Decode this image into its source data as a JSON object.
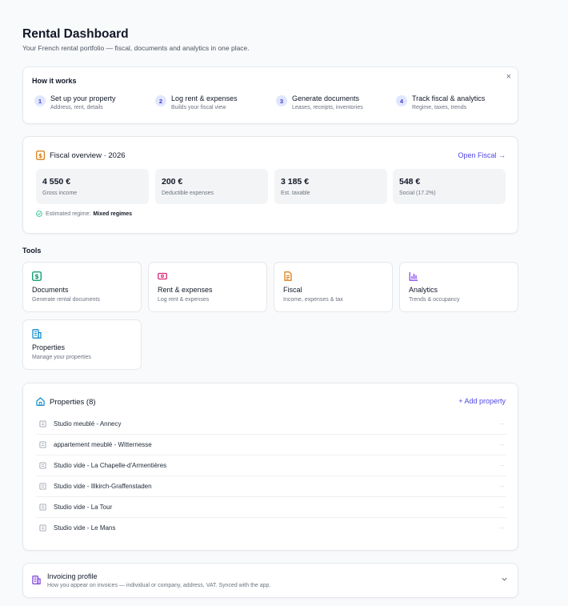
{
  "header": {
    "title": "Rental Dashboard",
    "subtitle": "Your French rental portfolio — fiscal, documents and analytics in one place."
  },
  "how_it_works": {
    "title": "How it works",
    "close_icon": "×",
    "steps": [
      {
        "num": "1",
        "title": "Set up your property",
        "desc": "Address, rent, details"
      },
      {
        "num": "2",
        "title": "Log rent & expenses",
        "desc": "Builds your fiscal view"
      },
      {
        "num": "3",
        "title": "Generate documents",
        "desc": "Leases, receipts, inventories"
      },
      {
        "num": "4",
        "title": "Track fiscal & analytics",
        "desc": "Regime, taxes, trends"
      }
    ]
  },
  "fiscal": {
    "title": "Fiscal overview · 2026",
    "link": "Open Fiscal →",
    "stats": [
      {
        "value": "4 550 €",
        "label": "Gross income"
      },
      {
        "value": "200 €",
        "label": "Deductible expenses"
      },
      {
        "value": "3 185 €",
        "label": "Est. taxable"
      },
      {
        "value": "548 €",
        "label": "Social (17.2%)"
      }
    ],
    "regime_label": "Estimated regime:",
    "regime_value": "Mixed regimes"
  },
  "tools": {
    "heading": "Tools",
    "items": [
      {
        "title": "Documents",
        "desc": "Generate rental documents",
        "icon": "document-dollar-icon",
        "color": "#059669"
      },
      {
        "title": "Rent & expenses",
        "desc": "Log rent & expenses",
        "icon": "banknote-icon",
        "color": "#db2777"
      },
      {
        "title": "Fiscal",
        "desc": "Income, expenses & tax",
        "icon": "file-text-icon",
        "color": "#d97706"
      },
      {
        "title": "Analytics",
        "desc": "Trends & occupancy",
        "icon": "bar-chart-icon",
        "color": "#7c3aed"
      },
      {
        "title": "Properties",
        "desc": "Manage your properties",
        "icon": "building-icon",
        "color": "#0284c7"
      }
    ]
  },
  "properties": {
    "title": "Properties (8)",
    "add_label": "+ Add property",
    "items": [
      "Studio meublé - Annecy",
      "appartement meublé - Witternesse",
      "Studio vide - La Chapelle-d'Armentières",
      "Studio vide - Illkirch-Graffenstaden",
      "Studio vide - La Tour",
      "Studio vide - Le Mans"
    ],
    "arrow": "→"
  },
  "invoicing": {
    "title": "Invoicing profile",
    "desc": "How you appear on invoices — individual or company, address, VAT. Synced with the app."
  },
  "colors": {
    "accent": "#4f46e5",
    "fiscal_icon": "#d97706",
    "properties_icon": "#0284c7",
    "invoicing_icon": "#6d28d9"
  }
}
